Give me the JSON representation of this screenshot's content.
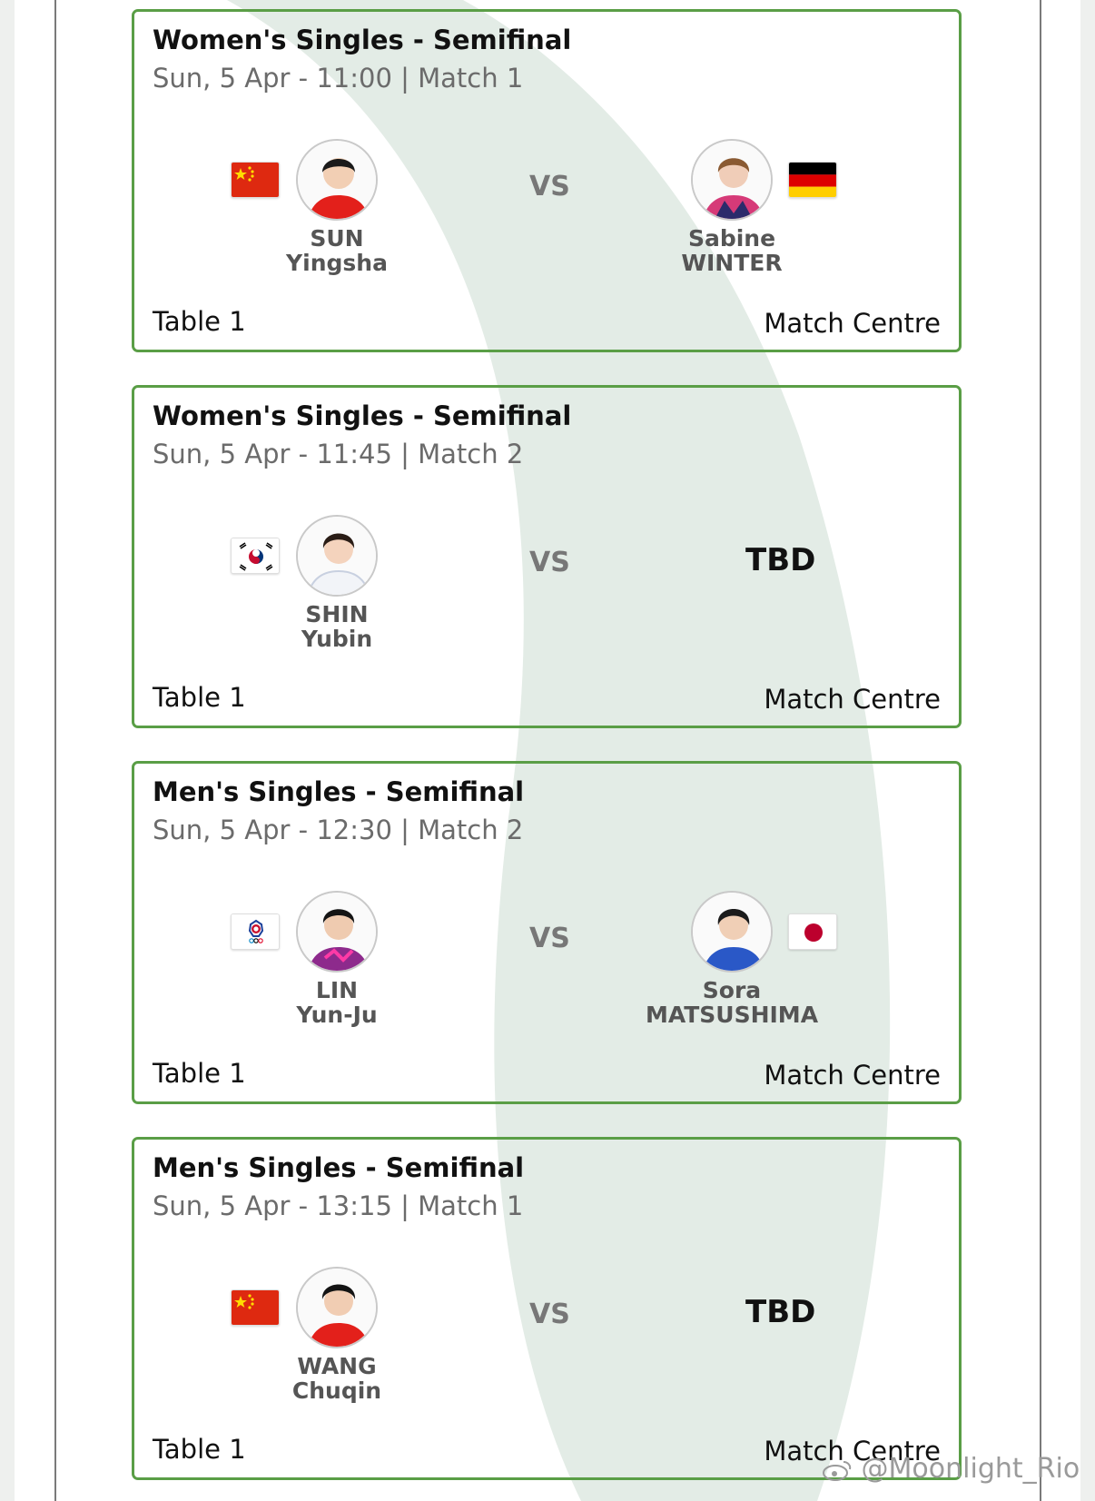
{
  "matches": [
    {
      "title": "Women's Singles - Semifinal",
      "subtitle": "Sun, 5 Apr - 11:00 | Match 1",
      "player1": {
        "first": "SUN",
        "last": "Yingsha",
        "flag": "china-flag",
        "avatar": "player-photo"
      },
      "vs": "VS",
      "player2": {
        "first": "Sabine",
        "last": "WINTER",
        "flag": "germany-flag",
        "avatar": "player-photo"
      },
      "table": "Table 1",
      "link": "Match Centre"
    },
    {
      "title": "Women's Singles - Semifinal",
      "subtitle": "Sun, 5 Apr - 11:45 | Match 2",
      "player1": {
        "first": "SHIN",
        "last": "Yubin",
        "flag": "south-korea-flag",
        "avatar": "player-photo"
      },
      "vs": "VS",
      "opponent": "TBD",
      "table": "Table 1",
      "link": "Match Centre"
    },
    {
      "title": "Men's Singles - Semifinal",
      "subtitle": "Sun, 5 Apr - 12:30 | Match 2",
      "player1": {
        "first": "LIN",
        "last": "Yun-Ju",
        "flag": "chinese-taipei-flag",
        "avatar": "player-photo"
      },
      "vs": "VS",
      "player2": {
        "first": "Sora",
        "last": "MATSUSHIMA",
        "flag": "japan-flag",
        "avatar": "player-photo"
      },
      "table": "Table 1",
      "link": "Match Centre"
    },
    {
      "title": "Men's Singles - Semifinal",
      "subtitle": "Sun, 5 Apr - 13:15 | Match 1",
      "player1": {
        "first": "WANG",
        "last": "Chuqin",
        "flag": "china-flag",
        "avatar": "player-photo"
      },
      "vs": "VS",
      "opponent": "TBD",
      "table": "Table 1",
      "link": "Match Centre"
    }
  ],
  "watermark": "@Moonlight_Rio",
  "colors": {
    "card_border": "#5a9e46",
    "background_arc": "#e3ece6",
    "subtitle": "#6b6b6b"
  }
}
